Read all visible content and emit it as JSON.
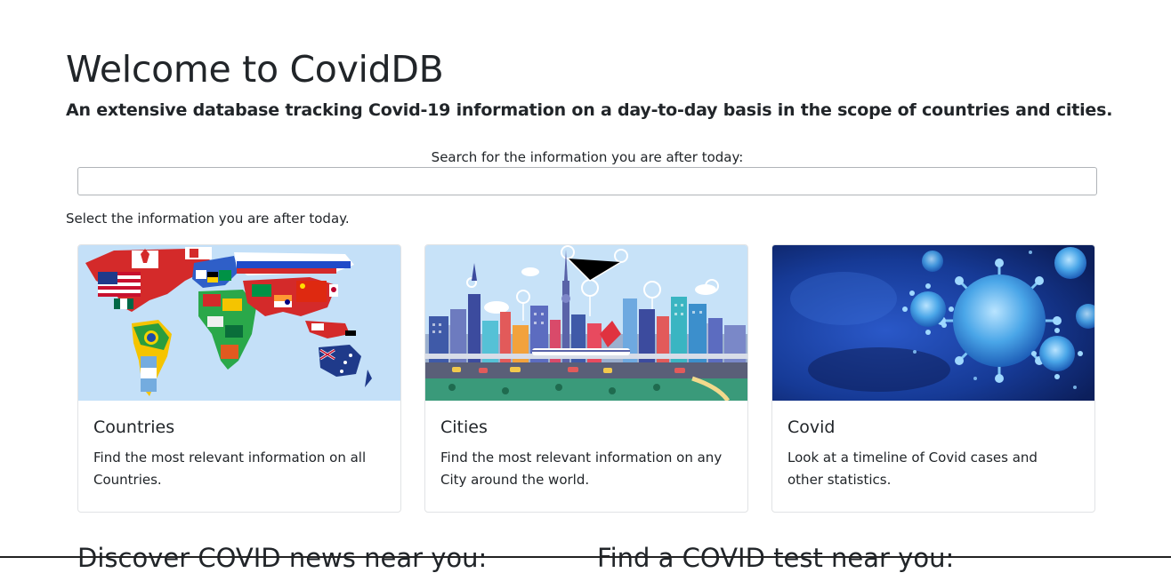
{
  "header": {
    "title": "Welcome to CovidDB",
    "subtitle": "An extensive database tracking Covid-19 information on a day-to-day basis in the scope of countries and cities."
  },
  "search": {
    "label": "Search for the information you are after today:",
    "value": "",
    "placeholder": ""
  },
  "select_prompt": "Select the information you are after today.",
  "cards": [
    {
      "title": "Countries",
      "text": "Find the most relevant information on all Countries.",
      "image": "world-map-of-flags"
    },
    {
      "title": "Cities",
      "text": "Find the most relevant information on any City around the world.",
      "image": "city-skyline-illustration"
    },
    {
      "title": "Covid",
      "text": "Look at a timeline of Covid cases and other statistics.",
      "image": "coronavirus-particles"
    }
  ],
  "sections": {
    "news_heading": "Discover COVID news near you:",
    "test_heading": "Find a COVID test near you:"
  },
  "colors": {
    "text": "#212529",
    "card_border": "#e1e3e5",
    "map_ocean": "#c4e0f8",
    "city_sky": "#c7e2f8",
    "virus_bg": "#1a3a9c"
  }
}
